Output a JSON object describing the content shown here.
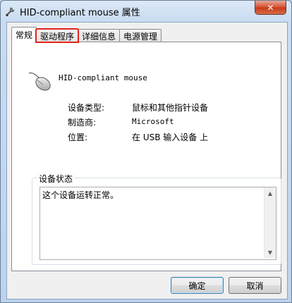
{
  "window": {
    "title": "HID-compliant mouse 属性",
    "close_label": "✕"
  },
  "tabs": [
    {
      "label": "常规"
    },
    {
      "label": "驱动程序"
    },
    {
      "label": "详细信息"
    },
    {
      "label": "电源管理"
    }
  ],
  "device": {
    "name": "HID-compliant mouse",
    "properties": [
      {
        "label": "设备类型:",
        "value": "鼠标和其他指针设备"
      },
      {
        "label": "制造商:",
        "value": "Microsoft"
      },
      {
        "label": "位置:",
        "value": "在 USB 输入设备 上"
      }
    ]
  },
  "status": {
    "legend": "设备状态",
    "text": "这个设备运转正常。"
  },
  "buttons": {
    "ok": "确定",
    "cancel": "取消"
  },
  "colors": {
    "highlight": "#e2231a",
    "close_button": "#c63a17"
  }
}
